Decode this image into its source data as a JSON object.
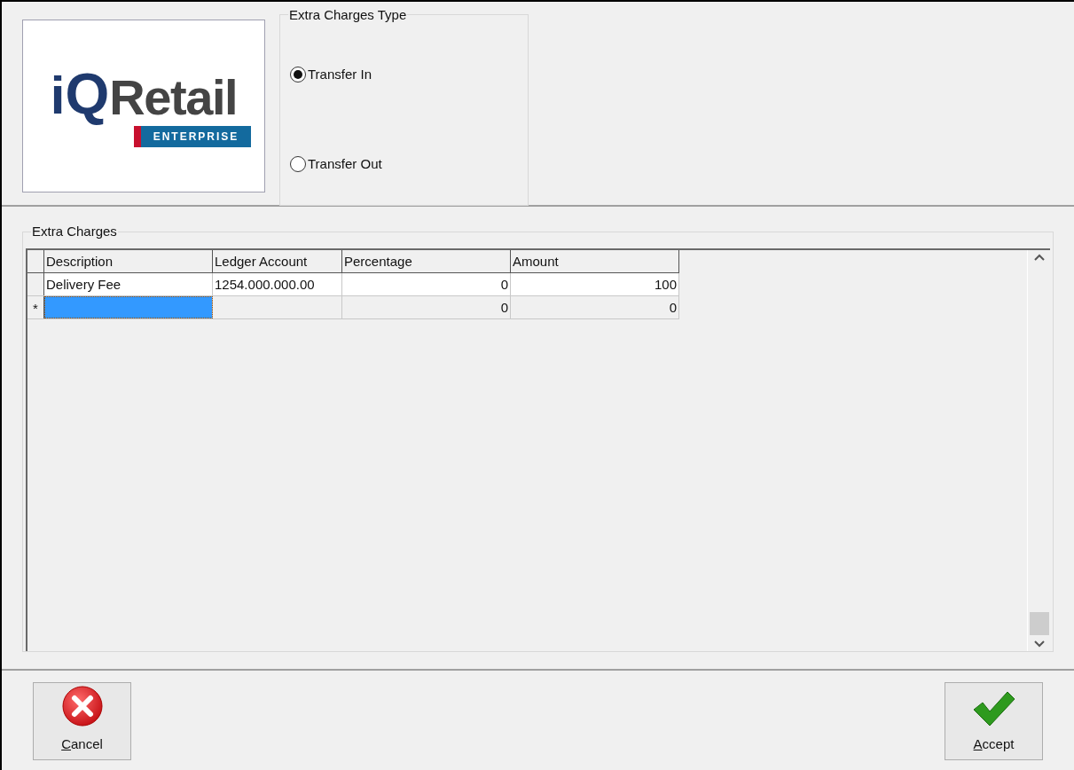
{
  "logo": {
    "mark_i": "i",
    "mark_q": "Q",
    "name": "Retail",
    "tagline": "ENTERPRISE"
  },
  "charges_type": {
    "title": "Extra Charges Type",
    "options": [
      {
        "label": "Transfer In",
        "selected": true
      },
      {
        "label": "Transfer Out",
        "selected": false
      }
    ]
  },
  "extra_charges": {
    "title": "Extra Charges",
    "columns": [
      "Description",
      "Ledger Account",
      "Percentage",
      "Amount"
    ],
    "rows": [
      {
        "new": false,
        "selected": false,
        "description": "Delivery Fee",
        "ledger_account": "1254.000.000.00",
        "percentage": "0",
        "amount": "100"
      },
      {
        "new": true,
        "selected": true,
        "indicator": "*",
        "percentage": "0",
        "amount": "0"
      }
    ]
  },
  "buttons": [
    {
      "kind": "cancel",
      "label": "Cancel"
    },
    {
      "kind": "accept",
      "label": "Accept"
    }
  ]
}
